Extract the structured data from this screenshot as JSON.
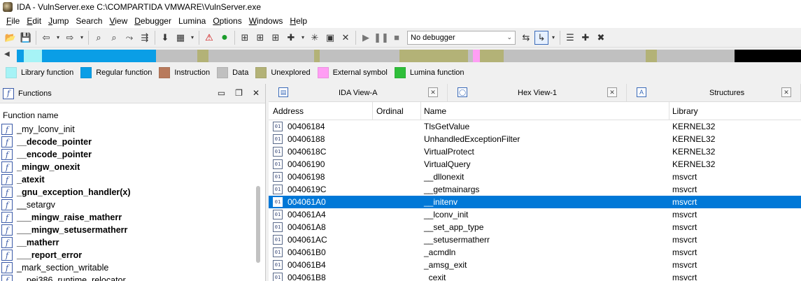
{
  "window": {
    "title": "IDA - VulnServer.exe C:\\COMPARTIDA VMWARE\\VulnServer.exe"
  },
  "menu": [
    {
      "label": "File",
      "ul": "F",
      "rest": "ile"
    },
    {
      "label": "Edit",
      "ul": "E",
      "rest": "dit"
    },
    {
      "label": "Jump",
      "ul": "J",
      "rest": "ump"
    },
    {
      "label": "Search",
      "ul": "",
      "rest": "Search"
    },
    {
      "label": "View",
      "ul": "V",
      "rest": "iew"
    },
    {
      "label": "Debugger",
      "ul": "D",
      "rest": "ebugger"
    },
    {
      "label": "Lumina",
      "ul": "",
      "rest": "Lumina"
    },
    {
      "label": "Options",
      "ul": "O",
      "rest": "ptions"
    },
    {
      "label": "Windows",
      "ul": "W",
      "rest": "indows"
    },
    {
      "label": "Help",
      "ul": "H",
      "rest": "elp"
    }
  ],
  "toolbar": {
    "debugger_select": "No debugger"
  },
  "legend": [
    {
      "label": "Library function",
      "color": "#a6f3f6"
    },
    {
      "label": "Regular function",
      "color": "#0a9ee6"
    },
    {
      "label": "Instruction",
      "color": "#b87a5c"
    },
    {
      "label": "Data",
      "color": "#c0c0c0"
    },
    {
      "label": "Unexplored",
      "color": "#b3b277"
    },
    {
      "label": "External symbol",
      "color": "#ff9ef4"
    },
    {
      "label": "Lumina function",
      "color": "#2fbe3a"
    }
  ],
  "functions_panel": {
    "title": "Functions",
    "column": "Function name",
    "items": [
      {
        "name": "_my_lconv_init",
        "bold": false
      },
      {
        "name": "__decode_pointer",
        "bold": true
      },
      {
        "name": "__encode_pointer",
        "bold": true
      },
      {
        "name": "_mingw_onexit",
        "bold": true
      },
      {
        "name": "_atexit",
        "bold": true
      },
      {
        "name": "_gnu_exception_handler(x)",
        "bold": true
      },
      {
        "name": "__setargv",
        "bold": false
      },
      {
        "name": "___mingw_raise_matherr",
        "bold": true
      },
      {
        "name": "___mingw_setusermatherr",
        "bold": true
      },
      {
        "name": "__matherr",
        "bold": true
      },
      {
        "name": "___report_error",
        "bold": true
      },
      {
        "name": "_mark_section_writable",
        "bold": false
      },
      {
        "name": "__pei386_runtime_relocator",
        "bold": false
      }
    ]
  },
  "tabs": [
    {
      "label": "IDA View-A",
      "icon": "▤"
    },
    {
      "label": "Hex View-1",
      "icon": "◯"
    },
    {
      "label": "Structures",
      "icon": "A"
    }
  ],
  "imports_table": {
    "columns": [
      "Address",
      "Ordinal",
      "Name",
      "Library"
    ],
    "rows": [
      {
        "address": "00406184",
        "name": "TlsGetValue",
        "library": "KERNEL32"
      },
      {
        "address": "00406188",
        "name": "UnhandledExceptionFilter",
        "library": "KERNEL32"
      },
      {
        "address": "0040618C",
        "name": "VirtualProtect",
        "library": "KERNEL32"
      },
      {
        "address": "00406190",
        "name": "VirtualQuery",
        "library": "KERNEL32"
      },
      {
        "address": "00406198",
        "name": "__dllonexit",
        "library": "msvcrt"
      },
      {
        "address": "0040619C",
        "name": "__getmainargs",
        "library": "msvcrt"
      },
      {
        "address": "004061A0",
        "name": "__initenv",
        "library": "msvcrt"
      },
      {
        "address": "004061A4",
        "name": "__lconv_init",
        "library": "msvcrt"
      },
      {
        "address": "004061A8",
        "name": "__set_app_type",
        "library": "msvcrt"
      },
      {
        "address": "004061AC",
        "name": "__setusermatherr",
        "library": "msvcrt"
      },
      {
        "address": "004061B0",
        "name": "_acmdln",
        "library": "msvcrt"
      },
      {
        "address": "004061B4",
        "name": "_amsg_exit",
        "library": "msvcrt"
      },
      {
        "address": "004061B8",
        "name": "_cexit",
        "library": "msvcrt"
      }
    ],
    "selected": "004061A0"
  }
}
